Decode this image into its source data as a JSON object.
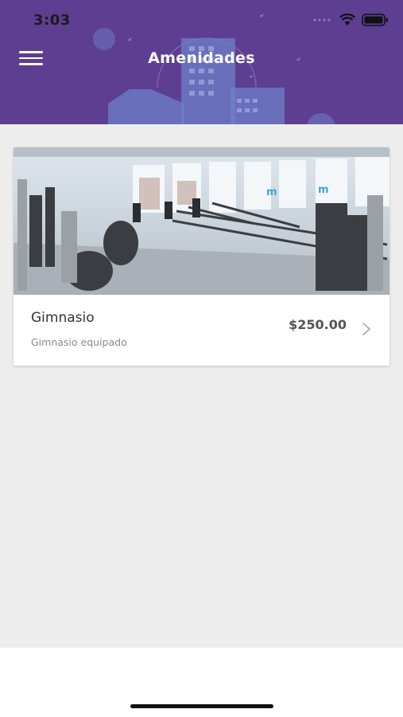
{
  "status_bar": {
    "time": "3:03"
  },
  "header": {
    "title": "Amenidades",
    "menu_icon": "hamburger-menu-icon"
  },
  "amenities": [
    {
      "name": "Gimnasio",
      "description": "Gimnasio equipado",
      "price": "$250.00",
      "image": "gym-photo"
    }
  ],
  "colors": {
    "header": "#5d3e91",
    "background": "#ededed",
    "card": "#ffffff"
  }
}
